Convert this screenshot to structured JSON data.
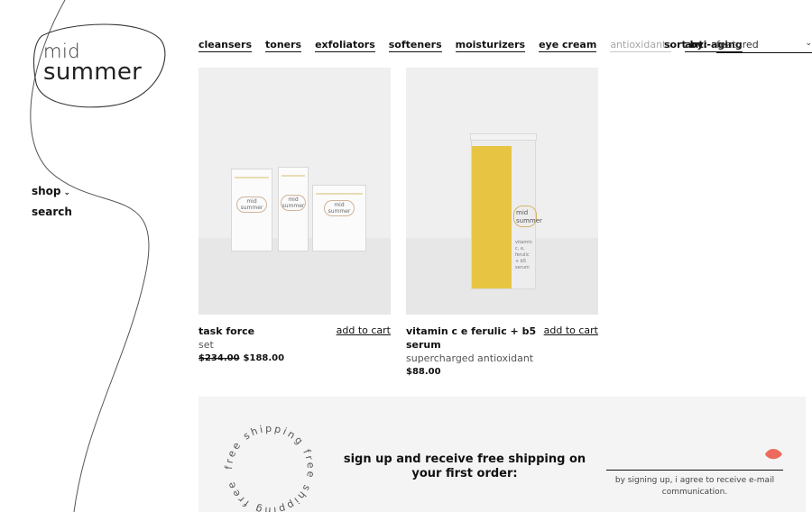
{
  "brand": {
    "word1": "mid",
    "word2": "summer"
  },
  "side_nav": {
    "shop_label": "shop",
    "search_label": "search"
  },
  "categories": [
    {
      "label": "cleansers"
    },
    {
      "label": "toners"
    },
    {
      "label": "exfoliators"
    },
    {
      "label": "softeners"
    },
    {
      "label": "moisturizers"
    },
    {
      "label": "eye cream"
    },
    {
      "label": "antioxidants"
    },
    {
      "label": "anti-aging"
    }
  ],
  "sort": {
    "label": "sort by:",
    "value": "featured"
  },
  "products": [
    {
      "name": "task force",
      "subtitle": "set",
      "old_price": "$234.00",
      "price": "$188.00",
      "cart_label": "add to cart",
      "package_texts": [
        "mid",
        "summer"
      ]
    },
    {
      "name": "vitamin c e ferulic + b5 serum",
      "subtitle": "supercharged antioxidant",
      "price": "$88.00",
      "cart_label": "add to cart",
      "package_texts": [
        "mid",
        "summer",
        "vitamin c, e,",
        "ferulic",
        "+ b5 serum"
      ]
    }
  ],
  "promo": {
    "circle_text": "free shipping free shipping free",
    "headline": "sign up and receive free shipping on your first order:",
    "consent": "by signing up, i agree to receive e-mail communication.",
    "submit_color": "#ec6b5e"
  },
  "colors": {
    "muted": "#a7a7a7",
    "accent": "#ec6b5e",
    "serum_yellow": "#e7c543"
  }
}
